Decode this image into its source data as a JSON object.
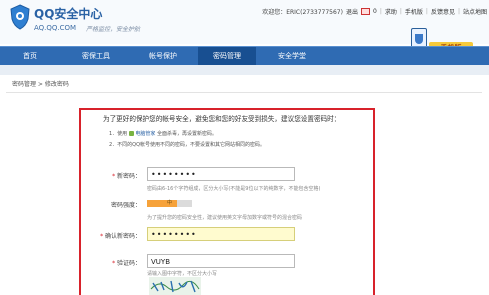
{
  "brand": {
    "title": "QQ安全中心",
    "domain": "AQ.QQ.COM",
    "slogan": "严格监控，安全护航"
  },
  "topbar": {
    "welcome": "欢迎您：ERIC(2733777567)",
    "logout": "退出",
    "inbox": "消息",
    "inbox_count": "0",
    "help": "求助",
    "mobile": "手机版",
    "feedback": "反馈意见",
    "sitemap": "站点地图"
  },
  "promo": {
    "label": "手机版"
  },
  "nav": {
    "items": [
      "首页",
      "密保工具",
      "帐号保护",
      "密码管理",
      "安全学堂"
    ],
    "active_index": 3
  },
  "breadcrumb": "密码管理 > 修改密码",
  "form": {
    "intro": "为了更好的保护您的帐号安全，避免您和您的好友受到损失，建议您设置密码时：",
    "rule1_prefix": "1．使用",
    "rule1_product": "电脑管家",
    "rule1_suffix": "全面杀毒，再设置新密码。",
    "rule2": "2．不同的QQ帐号使用不同的密码，不要设置和其它网站相同的密码。",
    "new_password_label": "新密码：",
    "new_password_value": "••••••••",
    "new_password_hint": "密码由6-16个字符组成，区分大小写(不能是9位以下的纯数字，不能包含空格)",
    "strength_label": "密码强度：",
    "strength_value": "中",
    "strength_level": 0.66,
    "strength_hint": "为了提升您的密码安全性，建议使用英文字母加数字或符号的混合密码",
    "confirm_label": "确认新密码：",
    "confirm_value": "••••••••",
    "captcha_label": "验证码：",
    "captcha_value": "VUYB",
    "captcha_hint": "请输入图中字符，不区分大小写"
  },
  "colors": {
    "nav_bg": "#2f6bb3",
    "nav_active": "#184f91",
    "brand_blue": "#2a62a5",
    "highlight_border": "#d8222b",
    "field_highlight": "#fffbcf"
  }
}
